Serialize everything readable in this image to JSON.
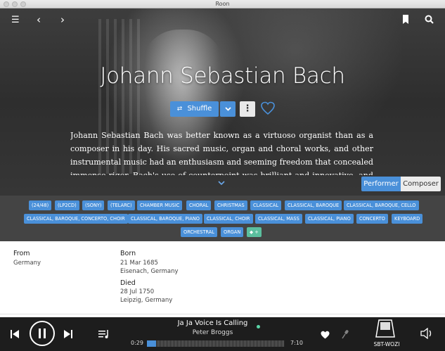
{
  "window": {
    "title": "Roon"
  },
  "artist": {
    "name": "Johann Sebastian Bach",
    "bio": "Johann Sebastian Bach was better known as a virtuoso organist than as a composer in his day. His sacred music, organ and choral works, and other instrumental music had an enthusiasm and seeming freedom that concealed immense rigor. Bach's use of counterpoint was brilliant and innovative, and the"
  },
  "actions": {
    "shuffle_label": "Shuffle"
  },
  "role_toggle": {
    "options": [
      "Performer",
      "Composer"
    ],
    "selected": "Performer"
  },
  "tags": [
    "(24/48)",
    "(LP2CD)",
    "(SONY)",
    "(TELARC)",
    "CHAMBER MUSIC",
    "CHORAL",
    "CHRISTMAS",
    "CLASSICAL",
    "CLASSICAL, BAROQUE",
    "CLASSICAL, BAROQUE, CELLO",
    "CLASSICAL, BAROQUE, CONCERTO, CHOIR",
    "CLASSICAL, BAROQUE, PIANO",
    "CLASSICAL, CHOIR",
    "CLASSICAL, MASS",
    "CLASSICAL, PIANO",
    "CONCERTO",
    "KEYBOARD",
    "ORCHESTRAL",
    "ORGAN"
  ],
  "tag_add_label": "+",
  "details": {
    "from": {
      "label": "From",
      "value": "Germany"
    },
    "born": {
      "label": "Born",
      "date": "21 Mar 1685",
      "place": "Eisenach, Germany"
    },
    "died": {
      "label": "Died",
      "date": "28 Jul 1750",
      "place": "Leipzig, Germany"
    }
  },
  "player": {
    "track_title": "Ja Ja Voice Is Calling",
    "track_artist": "Peter Broggs",
    "elapsed": "0:29",
    "duration": "7:10",
    "progress": 0.067,
    "zone_name": "SBT-WOZI",
    "accent_color": "#4a90d9"
  },
  "icons": [
    "menu-icon",
    "back-icon",
    "forward-icon",
    "bookmark-icon",
    "search-icon",
    "shuffle-icon",
    "chevron-down-icon",
    "more-icon",
    "heart-icon",
    "tag-icon",
    "previous-icon",
    "pause-icon",
    "next-icon",
    "queue-icon",
    "love-icon",
    "radio-icon",
    "zone-device-icon",
    "volume-icon"
  ]
}
